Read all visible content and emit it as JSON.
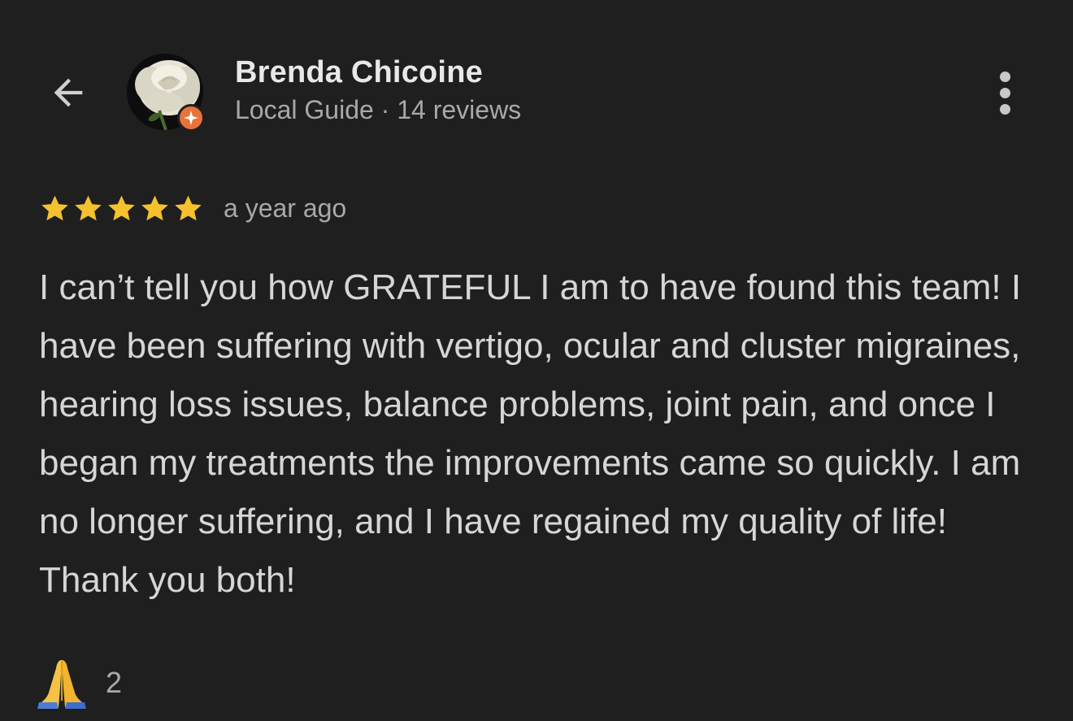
{
  "header": {
    "author_name": "Brenda Chicoine",
    "author_meta": "Local Guide · 14 reviews",
    "back_icon": "arrow-back-icon",
    "more_icon": "more-vert-icon",
    "badge_icon": "local-guide-badge-icon"
  },
  "review": {
    "rating": 5,
    "rating_max": 5,
    "date": "a year ago",
    "text": "I can’t tell you how GRATEFUL I am to have found this team! I have been suffering with vertigo, ocular and cluster migraines, hearing loss issues, balance problems, joint pain, and once I began my treatments the improvements came so quickly. I am no longer suffering, and I have regained my quality of life! Thank you both!"
  },
  "reaction": {
    "emoji": "folded-hands-icon",
    "count": "2"
  },
  "colors": {
    "background": "#1f1f1f",
    "star": "#f5c12e",
    "badge": "#e8733a",
    "text_primary": "#e8e8e8",
    "text_secondary": "#a9a9a9"
  }
}
